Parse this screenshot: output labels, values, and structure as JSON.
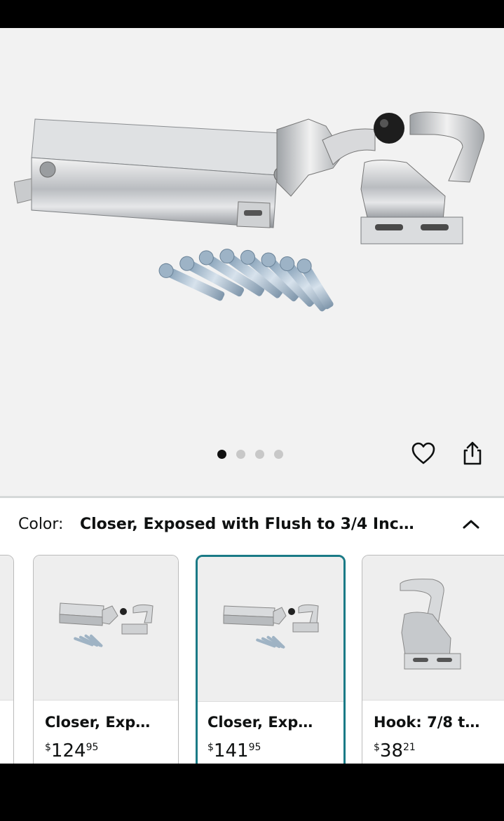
{
  "gallery": {
    "image_count": 4,
    "active_index": 0,
    "heart_icon": "heart-outline-icon",
    "share_icon": "share-icon"
  },
  "color_selector": {
    "label": "Color:",
    "value": "Closer, Exposed with Flush to 3/4 Inc…",
    "collapse_icon": "chevron-up-icon"
  },
  "variants": [
    {
      "name": "Closer, Exp…",
      "currency": "$",
      "whole": "124",
      "fraction": "95",
      "selected": false
    },
    {
      "name": "Closer, Exp…",
      "currency": "$",
      "whole": "141",
      "fraction": "95",
      "selected": true
    },
    {
      "name": "Hook: 7/8 t…",
      "currency": "$",
      "whole": "38",
      "fraction": "21",
      "selected": false
    }
  ],
  "colors": {
    "selected_border": "#1a7a86",
    "active_dot": "#111111",
    "inactive_dot": "#c8c8c8"
  }
}
